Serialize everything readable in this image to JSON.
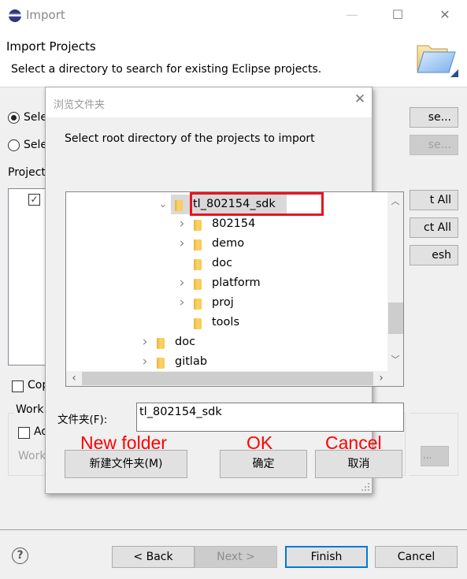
{
  "window": {
    "title": "Import",
    "controls": {
      "minimize": "—",
      "maximize": "☐",
      "close": "✕"
    }
  },
  "header": {
    "title": "Import Projects",
    "description": "Select a directory to search for existing Eclipse projects."
  },
  "background": {
    "radio_root": "Sele",
    "radio_archive": "Sele",
    "projects_label": "Project",
    "browse_btn": "se...",
    "browse_archive_btn": "se...",
    "select_all_btn": "t All",
    "deselect_all_btn": "ct All",
    "refresh_btn": "esh",
    "copy_checkbox": "Cop",
    "working_sets_label": "Work",
    "add_checkbox": "Ad",
    "working_sets_field": "Work",
    "browse3_btn": "..."
  },
  "footer": {
    "back": "< Back",
    "next": "Next >",
    "finish": "Finish",
    "cancel": "Cancel"
  },
  "dialog": {
    "title": "浏览文件夹",
    "prompt": "Select root directory of the projects to import",
    "tree": [
      {
        "label": "tl_802154_sdk",
        "level": 0,
        "expander": "expanded",
        "selected": true
      },
      {
        "label": "802154",
        "level": 1,
        "expander": "collapsed"
      },
      {
        "label": "demo",
        "level": 1,
        "expander": "collapsed"
      },
      {
        "label": "doc",
        "level": 1,
        "expander": "none"
      },
      {
        "label": "platform",
        "level": 1,
        "expander": "collapsed"
      },
      {
        "label": "proj",
        "level": 1,
        "expander": "collapsed"
      },
      {
        "label": "tools",
        "level": 1,
        "expander": "none"
      },
      {
        "label": "doc",
        "level": -1,
        "expander": "collapsed"
      },
      {
        "label": "gitlab",
        "level": -1,
        "expander": "collapsed"
      }
    ],
    "folder_label": "文件夹(F):",
    "folder_value": "tl_802154_sdk",
    "buttons": {
      "new_folder": "新建文件夹(M)",
      "ok": "确定",
      "cancel": "取消"
    },
    "annotations": {
      "new_folder": "New folder",
      "ok": "OK",
      "cancel": "Cancel"
    },
    "highlight_color": "#e8141f"
  }
}
